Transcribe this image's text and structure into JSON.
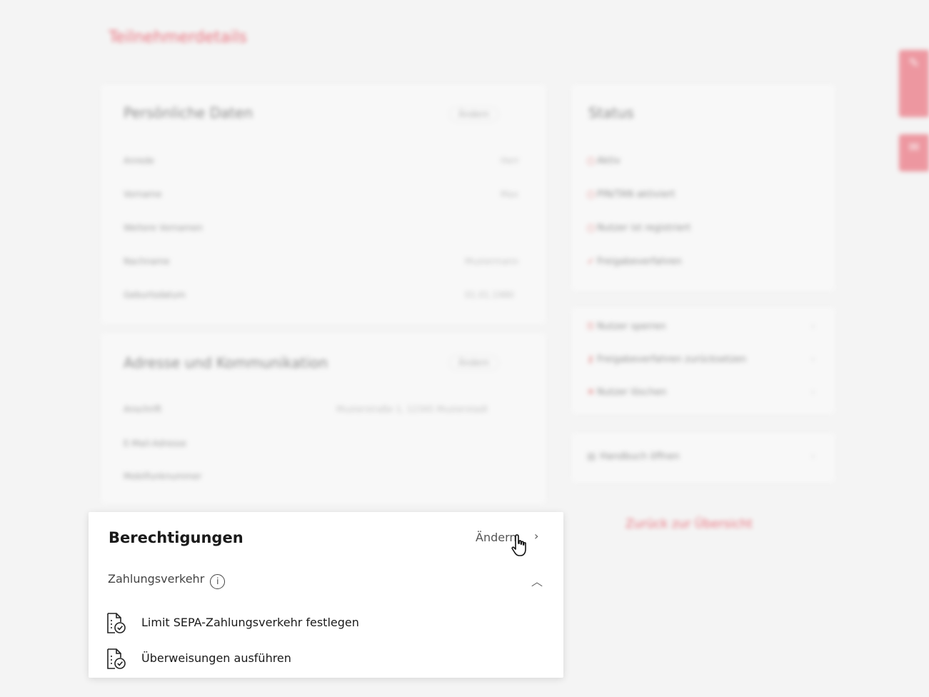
{
  "page_title": "Teilnehmerdetails",
  "personal_card": {
    "title": "Persönliche Daten",
    "action": "Ändern",
    "rows": [
      {
        "label": "Anrede",
        "value": "Herr"
      },
      {
        "label": "Vorname",
        "value": "Max"
      },
      {
        "label": "Weitere Vornamen",
        "value": ""
      },
      {
        "label": "Nachname",
        "value": "Mustermann"
      },
      {
        "label": "Geburtsdatum",
        "value": "01.01.1980"
      }
    ]
  },
  "address_card": {
    "title": "Adresse und Kommunikation",
    "action": "Ändern",
    "rows": [
      {
        "label": "Anschrift",
        "value": "Musterstraße 1, 12345 Musterstadt"
      },
      {
        "label": "E-Mail-Adresse",
        "value": ""
      },
      {
        "label": "Mobilfunknummer",
        "value": ""
      }
    ]
  },
  "status_card": {
    "title": "Status",
    "items": [
      {
        "icon": "circle-icon",
        "label": "Aktiv"
      },
      {
        "icon": "circle-icon",
        "label": "PIN/TAN aktiviert"
      },
      {
        "icon": "circle-icon",
        "label": "Nutzer ist registriert"
      },
      {
        "icon": "check-icon",
        "label": "Freigabeverfahren"
      }
    ]
  },
  "actions_card": {
    "items": [
      {
        "icon": "lock-icon",
        "label": "Nutzer sperren"
      },
      {
        "icon": "key-icon",
        "label": "Freigabeverfahren zurücksetzen"
      },
      {
        "icon": "close-icon",
        "label": "Nutzer löschen"
      }
    ]
  },
  "handbook": {
    "label": "Handbuch öffnen"
  },
  "back_button": "Zurück zur Übersicht",
  "permissions": {
    "title": "Berechtigungen",
    "change_label": "Ändern",
    "section_label": "Zahlungsverkehr",
    "items": [
      {
        "label": "Limit SEPA-Zahlungsverkehr festlegen"
      },
      {
        "label": "Überweisungen ausführen"
      }
    ]
  },
  "colors": {
    "accent": "#e2001a",
    "side_tab": "#e74c5c"
  }
}
